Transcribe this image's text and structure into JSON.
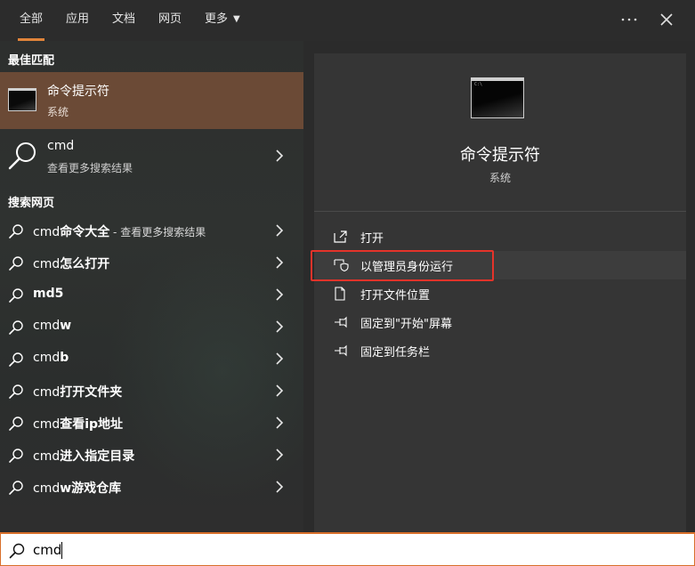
{
  "tabs": [
    {
      "label": "全部",
      "active": true
    },
    {
      "label": "应用",
      "active": false
    },
    {
      "label": "文档",
      "active": false
    },
    {
      "label": "网页",
      "active": false
    },
    {
      "label": "更多",
      "active": false,
      "dropdown": true
    }
  ],
  "topbar": {
    "more_icon": "ellipsis-icon",
    "close_icon": "close-icon"
  },
  "left": {
    "best_match_header": "最佳匹配",
    "best_match": {
      "title": "命令提示符",
      "subtitle": "系统",
      "icon": "command-prompt-icon"
    },
    "cmd_result": {
      "title": "cmd",
      "subtitle": "查看更多搜索结果",
      "icon": "search-icon"
    },
    "web_header": "搜索网页",
    "web_items": [
      {
        "prefix": "cmd",
        "bold": "命令大全",
        "suffix": " - 查看更多搜索结果"
      },
      {
        "prefix": "cmd",
        "bold": "怎么打开",
        "suffix": ""
      },
      {
        "prefix": "",
        "bold": "md5",
        "suffix": ""
      },
      {
        "prefix": "cmd",
        "bold": "w",
        "suffix": ""
      },
      {
        "prefix": "cmd",
        "bold": "b",
        "suffix": ""
      },
      {
        "prefix": "cmd",
        "bold": "打开文件夹",
        "suffix": ""
      },
      {
        "prefix": "cmd",
        "bold": "查看ip地址",
        "suffix": ""
      },
      {
        "prefix": "cmd",
        "bold": "进入指定目录",
        "suffix": ""
      },
      {
        "prefix": "cmd",
        "bold": "w游戏仓库",
        "suffix": ""
      }
    ]
  },
  "preview": {
    "title": "命令提示符",
    "subtitle": "系统",
    "actions": [
      {
        "label": "打开",
        "icon": "open-icon"
      },
      {
        "label": "以管理员身份运行",
        "icon": "shield-icon"
      },
      {
        "label": "打开文件位置",
        "icon": "file-location-icon"
      },
      {
        "label": "固定到\"开始\"屏幕",
        "icon": "pin-icon"
      },
      {
        "label": "固定到任务栏",
        "icon": "pin-icon"
      }
    ]
  },
  "search": {
    "value": "cmd"
  },
  "colors": {
    "accent": "#e0843a",
    "selected": "#6b4a36",
    "highlight_box": "#e5332a"
  }
}
